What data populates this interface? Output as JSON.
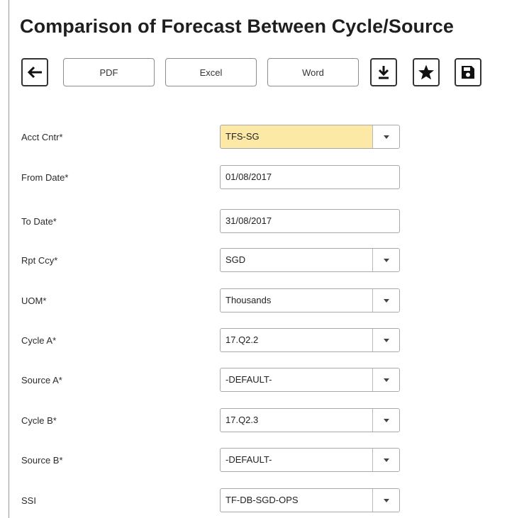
{
  "page": {
    "title": "Comparison of Forecast Between Cycle/Source"
  },
  "toolbar": {
    "back_icon": "arrow-left-icon",
    "pdf_label": "PDF",
    "excel_label": "Excel",
    "word_label": "Word",
    "download_icon": "download-icon",
    "favorite_icon": "star-icon",
    "save_icon": "save-icon"
  },
  "form": {
    "fields": [
      {
        "label": "Acct Cntr*",
        "value": "TFS-SG",
        "type": "select",
        "highlight": true
      },
      {
        "label": "From Date*",
        "value": "01/08/2017",
        "type": "text"
      },
      {
        "label": "To Date*",
        "value": "31/08/2017",
        "type": "text"
      },
      {
        "label": "Rpt Ccy*",
        "value": "SGD",
        "type": "select"
      },
      {
        "label": "UOM*",
        "value": "Thousands",
        "type": "select"
      },
      {
        "label": "Cycle A*",
        "value": "17.Q2.2",
        "type": "select"
      },
      {
        "label": "Source A*",
        "value": "-DEFAULT-",
        "type": "select"
      },
      {
        "label": "Cycle B*",
        "value": "17.Q2.3",
        "type": "select"
      },
      {
        "label": "Source B*",
        "value": "-DEFAULT-",
        "type": "select"
      },
      {
        "label": "SSI",
        "value": "TF-DB-SGD-OPS",
        "type": "select"
      }
    ]
  },
  "colors": {
    "highlight_field": "#fde9a6",
    "border": "#a8a8a8"
  }
}
